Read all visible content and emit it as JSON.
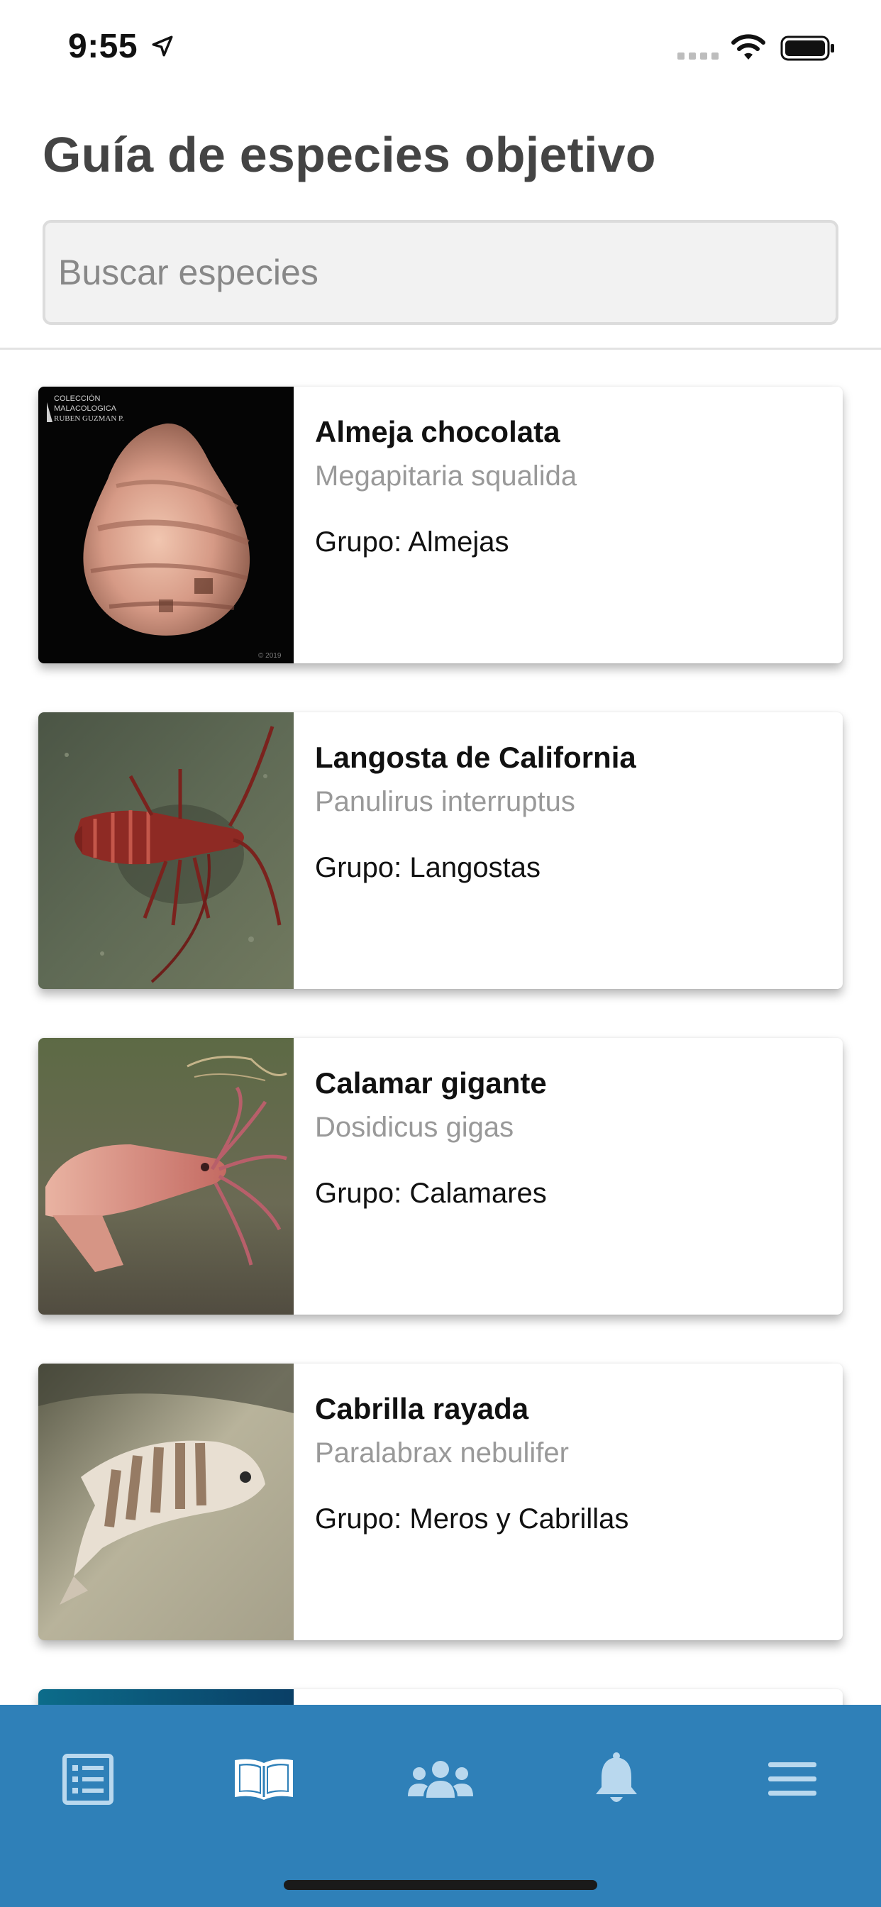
{
  "status_bar": {
    "time": "9:55"
  },
  "header": {
    "title": "Guía de especies objetivo"
  },
  "search": {
    "placeholder": "Buscar especies",
    "value": ""
  },
  "species": [
    {
      "common_name": "Almeja chocolata",
      "scientific_name": "Megapitaria squalida",
      "group": "Grupo: Almejas",
      "image_caption_line1": "COLECCIÓN",
      "image_caption_line2": "MALACOLOGICA",
      "image_caption_line3": "RUBEN GUZMAN P.",
      "image_year": "© 2019"
    },
    {
      "common_name": "Langosta de California",
      "scientific_name": "Panulirus interruptus",
      "group": "Grupo: Langostas"
    },
    {
      "common_name": "Calamar gigante",
      "scientific_name": "Dosidicus gigas",
      "group": "Grupo: Calamares"
    },
    {
      "common_name": "Cabrilla rayada",
      "scientific_name": "Paralabrax nebulifer",
      "group": "Grupo: Meros y Cabrillas"
    }
  ],
  "bottom_nav": {
    "items": [
      {
        "icon": "list-icon",
        "active": false
      },
      {
        "icon": "book-open-icon",
        "active": true
      },
      {
        "icon": "users-icon",
        "active": false
      },
      {
        "icon": "bell-icon",
        "active": false
      },
      {
        "icon": "menu-icon",
        "active": false
      }
    ]
  },
  "colors": {
    "nav_background": "#2f80b8",
    "nav_icon": "#b9d8ee",
    "nav_icon_active": "#ffffff",
    "title": "#444444",
    "scientific_name": "#999999"
  }
}
